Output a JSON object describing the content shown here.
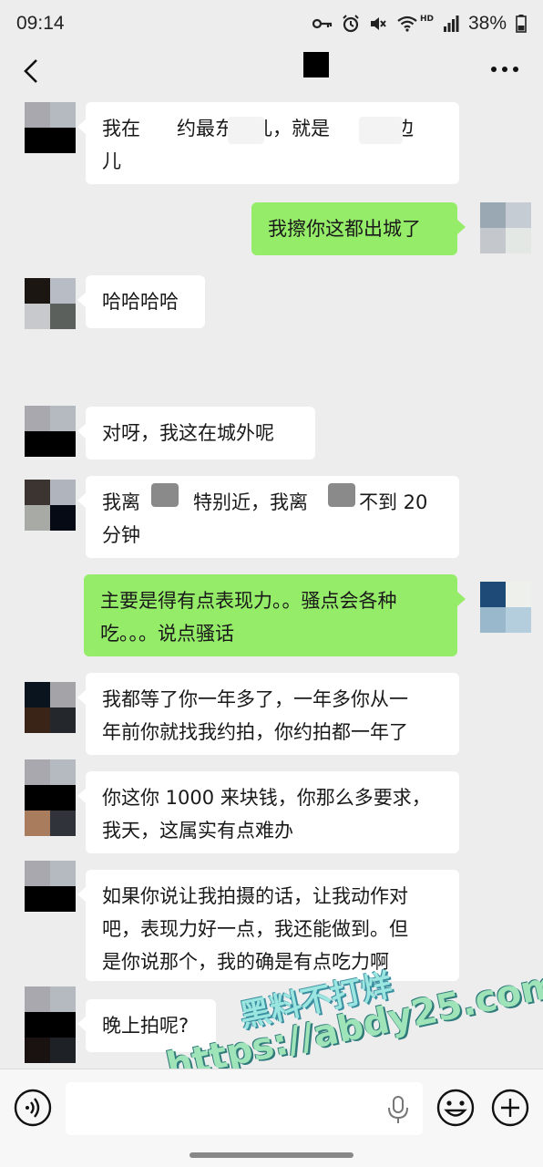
{
  "status_bar": {
    "time": "09:14",
    "network_badge": "HD",
    "battery": "38%"
  },
  "header": {
    "back_icon": "chevron-left-icon",
    "more_icon": "more-dots-icon"
  },
  "messages": [
    {
      "side": "left",
      "lines": [
        "我在",
        "约最东边儿，就是",
        "路边",
        "儿"
      ]
    },
    {
      "side": "right",
      "text": "我擦你这都出城了"
    },
    {
      "side": "left",
      "text": "哈哈哈哈"
    },
    {
      "side": "left",
      "text": "对呀，我这在城外呢"
    },
    {
      "side": "left",
      "lines": [
        "我离",
        "特别近，我离",
        "不到 20",
        "分钟"
      ]
    },
    {
      "side": "right",
      "lines": [
        "主要是得有点表现力。。骚点会各种",
        "吃。。。说点骚话"
      ]
    },
    {
      "side": "left",
      "lines": [
        "我都等了你一年多了，一年多你从一",
        "年前你就找我约拍，你约拍都一年了"
      ]
    },
    {
      "side": "left",
      "lines": [
        "你这你 1000 来块钱，你那么多要求，",
        "我天，这属实有点难办"
      ]
    },
    {
      "side": "left",
      "lines": [
        "如果你说让我拍摄的话，让我动作对",
        "吧，表现力好一点，我还能做到。但",
        "是你说那个，我的确是有点吃力啊"
      ]
    },
    {
      "side": "left",
      "text": "晚上拍呢?"
    }
  ],
  "watermark": {
    "line1": "黑料不打烊",
    "line2": "https://abdy25.com"
  },
  "input_bar": {
    "placeholder": "",
    "voice_icon": "voice-icon",
    "mic_icon": "mic-icon",
    "emoji_icon": "emoji-icon",
    "plus_icon": "plus-icon"
  },
  "colors": {
    "background": "#ededed",
    "bubble_left": "#ffffff",
    "bubble_right": "#95ec69"
  }
}
